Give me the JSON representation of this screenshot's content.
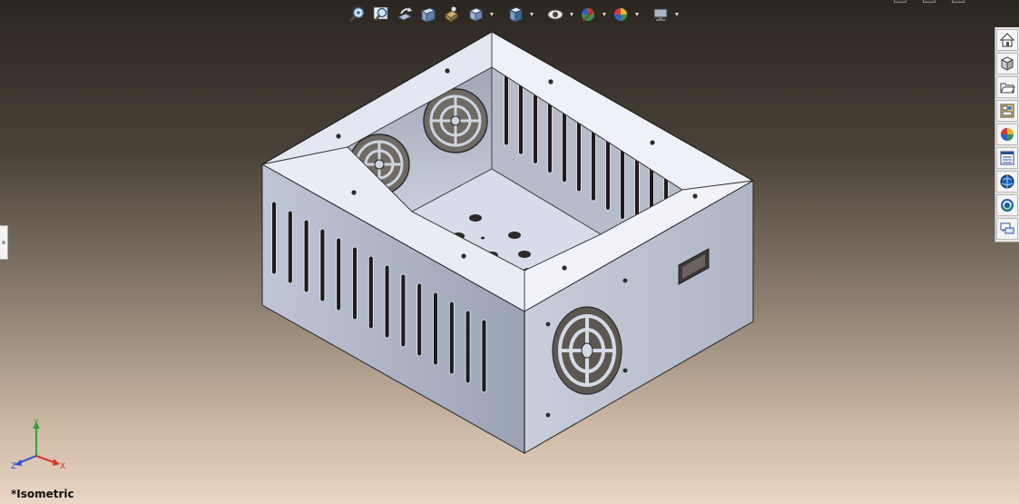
{
  "view": {
    "orientation_label": "*Isometric"
  },
  "triad": {
    "x_label": "X",
    "y_label": "Y",
    "z_label": "Z"
  },
  "heads_up_toolbar": {
    "buttons": [
      {
        "name": "zoom-to-fit-icon"
      },
      {
        "name": "zoom-to-area-icon"
      },
      {
        "name": "previous-view-icon"
      },
      {
        "name": "section-view-icon"
      },
      {
        "name": "dynamic-annotation-icon"
      },
      {
        "name": "view-orientation-icon"
      },
      {
        "name": "display-style-icon"
      },
      {
        "name": "hide-show-items-icon"
      },
      {
        "name": "edit-appearance-icon"
      },
      {
        "name": "apply-scene-icon"
      },
      {
        "name": "view-settings-icon"
      }
    ]
  },
  "task_pane": {
    "tabs": [
      {
        "name": "solidworks-resources-icon"
      },
      {
        "name": "design-library-icon"
      },
      {
        "name": "file-explorer-icon"
      },
      {
        "name": "view-palette-icon"
      },
      {
        "name": "appearances-scenes-icon"
      },
      {
        "name": "custom-properties-icon"
      },
      {
        "name": "solidworks-forum-icon"
      },
      {
        "name": "toolbox-icon"
      },
      {
        "name": "discussion-icon"
      }
    ]
  },
  "colors": {
    "background_top": "#2b2620",
    "background_bottom": "#ead6c3",
    "model_light": "#dfe4f2",
    "model_mid": "#aeb5c6",
    "model_dark": "#8a91a1",
    "triad_x": "#d8322c",
    "triad_y": "#2ea23a",
    "triad_z": "#2c4fd8"
  }
}
